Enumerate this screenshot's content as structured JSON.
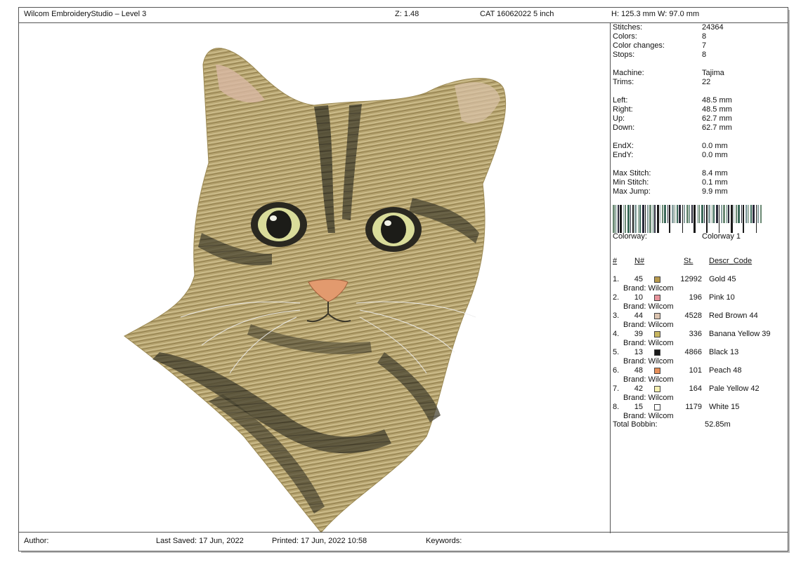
{
  "header": {
    "app_title": "Wilcom EmbroideryStudio – Level 3",
    "zoom": "Z: 1.48",
    "design_name": "CAT 16062022 5 inch",
    "size": "H: 125.3 mm   W: 97.0 mm"
  },
  "stats": [
    {
      "label": "Stitches:",
      "value": "24364"
    },
    {
      "label": "Colors:",
      "value": "8"
    },
    {
      "label": "Color changes:",
      "value": "7"
    },
    {
      "label": "Stops:",
      "value": "8"
    },
    {
      "label": "Machine:",
      "value": "Tajima"
    },
    {
      "label": "Trims:",
      "value": "22"
    },
    {
      "label": "Left:",
      "value": "48.5 mm"
    },
    {
      "label": "Right:",
      "value": "48.5 mm"
    },
    {
      "label": "Up:",
      "value": "62.7 mm"
    },
    {
      "label": "Down:",
      "value": "62.7 mm"
    },
    {
      "label": "EndX:",
      "value": "0.0 mm"
    },
    {
      "label": "EndY:",
      "value": "0.0 mm"
    },
    {
      "label": "Max Stitch:",
      "value": "8.4 mm"
    },
    {
      "label": "Min Stitch:",
      "value": "0.1 mm"
    },
    {
      "label": "Max Jump:",
      "value": "9.9 mm"
    }
  ],
  "colorway": {
    "label": "Colorway:",
    "value": "Colorway 1"
  },
  "table_headers": {
    "num": "#",
    "n": "N#",
    "st": "St.",
    "descr": "Descr_Code"
  },
  "threads": [
    {
      "idx": "1.",
      "n": "45",
      "color": "#b89a4e",
      "st": "12992",
      "descr": "Gold 45",
      "brand": "Brand: Wilcom"
    },
    {
      "idx": "2.",
      "n": "10",
      "color": "#e8949c",
      "st": "196",
      "descr": "Pink 10",
      "brand": "Brand: Wilcom"
    },
    {
      "idx": "3.",
      "n": "44",
      "color": "#dcc4b0",
      "st": "4528",
      "descr": "Red Brown 44",
      "brand": "Brand: Wilcom"
    },
    {
      "idx": "4.",
      "n": "39",
      "color": "#c8b660",
      "st": "336",
      "descr": "Banana Yellow 39",
      "brand": "Brand: Wilcom"
    },
    {
      "idx": "5.",
      "n": "13",
      "color": "#1a1a1a",
      "st": "4866",
      "descr": "Black 13",
      "brand": "Brand: Wilcom"
    },
    {
      "idx": "6.",
      "n": "48",
      "color": "#e8905a",
      "st": "101",
      "descr": "Peach 48",
      "brand": "Brand: Wilcom"
    },
    {
      "idx": "7.",
      "n": "42",
      "color": "#f4efb0",
      "st": "164",
      "descr": "Pale Yellow 42",
      "brand": "Brand: Wilcom"
    },
    {
      "idx": "8.",
      "n": "15",
      "color": "#ffffff",
      "st": "1179",
      "descr": "White 15",
      "brand": "Brand: Wilcom"
    }
  ],
  "total_bobbin": {
    "label": "Total Bobbin:",
    "value": "52.85m"
  },
  "footer": {
    "author": "Author:",
    "last_saved": "Last Saved: 17 Jun, 2022",
    "printed": "Printed: 17 Jun, 2022 10:58",
    "keywords": "Keywords:"
  }
}
